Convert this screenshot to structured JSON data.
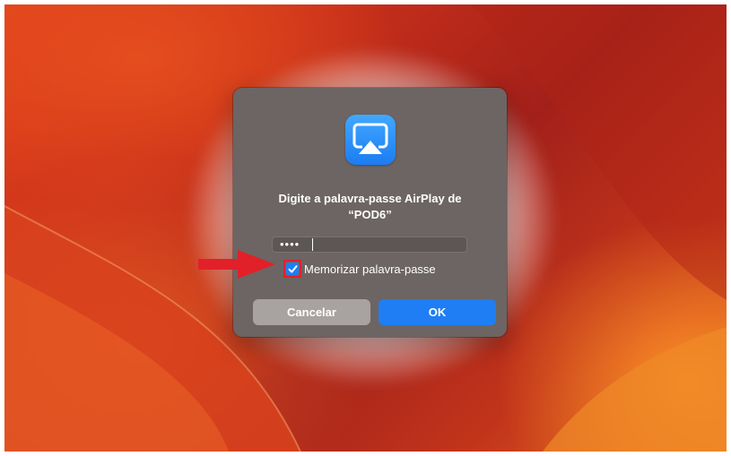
{
  "dialog": {
    "app_icon": "airplay-icon",
    "title_line1": "Digite a palavra-passe AirPlay de",
    "title_line2": "“POD6”",
    "password_value": "••••",
    "remember_label": "Memorizar palavra-passe",
    "remember_checked": true,
    "cancel_label": "Cancelar",
    "ok_label": "OK"
  },
  "annotation": {
    "arrow_icon": "red-arrow-right-icon",
    "highlight_color": "#e2202a"
  },
  "colors": {
    "accent": "#1f7ef4",
    "dialog_bg": "#6c6563",
    "wallpaper": "#c9301a"
  }
}
